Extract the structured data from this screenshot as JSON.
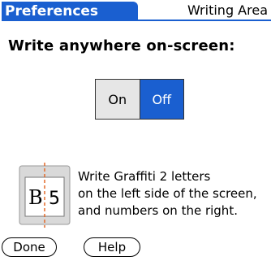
{
  "header": {
    "title": "Preferences",
    "category": "Writing Area"
  },
  "main": {
    "heading": "Write anywhere on-screen:",
    "toggle": {
      "on_label": "On",
      "off_label": "Off",
      "selected": "Off"
    },
    "graffiti": {
      "icon_letter": "B",
      "icon_number": "5",
      "lines": [
        "Write Graffiti 2 letters",
        "on the  left side of the screen,",
        "and  numbers on the right."
      ]
    }
  },
  "buttons": {
    "done_label": "Done",
    "help_label": "Help"
  },
  "colors": {
    "accent": "#1a5fd0",
    "guide_line": "#e36a2a",
    "icon_panel": "#d9d9d9"
  },
  "icons": {
    "writing_area": "graffiti-writing-area-icon"
  }
}
